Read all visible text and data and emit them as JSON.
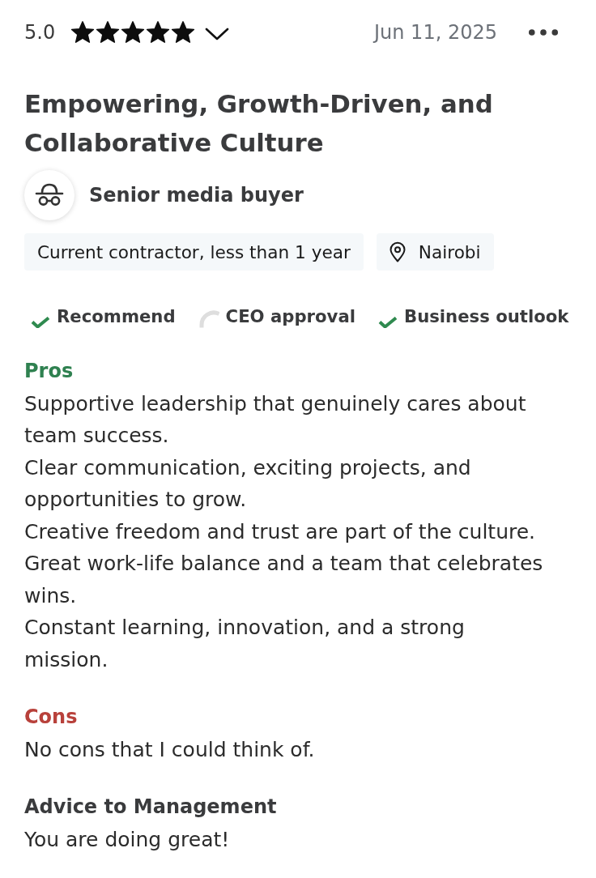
{
  "review": {
    "rating": "5.0",
    "stars": 5,
    "date": "Jun 11, 2025",
    "title": "Empowering, Growth-Driven, and Collaborative Culture",
    "author_role": "Senior media buyer",
    "tags": [
      {
        "kind": "employment",
        "text": "Current contractor, less than 1 year"
      },
      {
        "kind": "location",
        "text": "Nairobi"
      }
    ],
    "indicators": [
      {
        "label": "Recommend",
        "kind": "positive"
      },
      {
        "label": "CEO approval",
        "kind": "neutral"
      },
      {
        "label": "Business outlook",
        "kind": "positive"
      }
    ],
    "sections": [
      {
        "kind": "pros",
        "heading": "Pros",
        "lines": [
          "Supportive leadership that genuinely cares about team success.",
          "Clear communication, exciting projects, and opportunities to grow.",
          "Creative freedom and trust are part of the culture.",
          "Great work-life balance and a team that celebrates wins.",
          "Constant learning, innovation, and a strong mission."
        ]
      },
      {
        "kind": "cons",
        "heading": "Cons",
        "lines": [
          "No cons that I could think of."
        ]
      },
      {
        "kind": "advice",
        "heading": "Advice to Management",
        "lines": [
          "You are doing great!"
        ]
      }
    ]
  }
}
